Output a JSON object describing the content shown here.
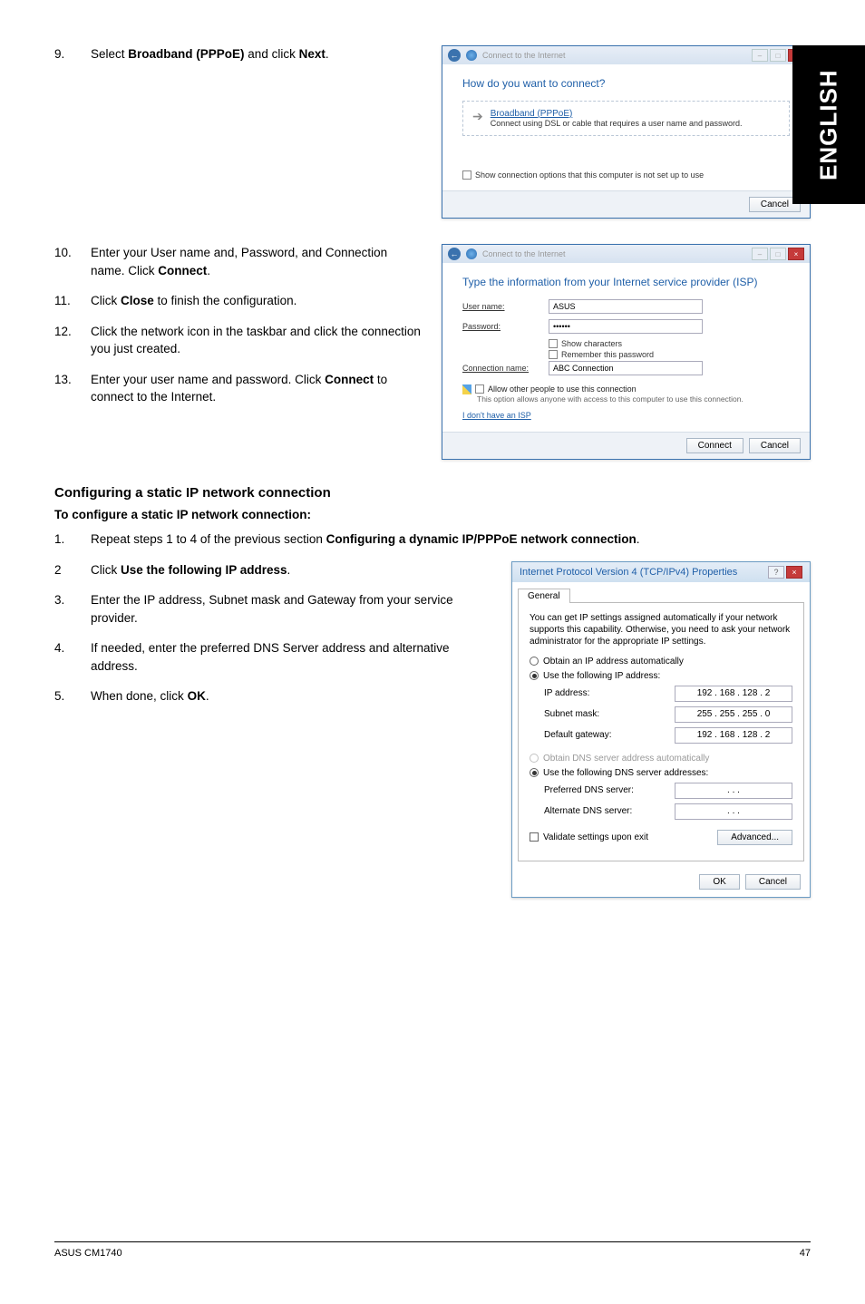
{
  "side_tab": "ENGLISH",
  "step9": {
    "num": "9.",
    "text_pre": "Select ",
    "bold": "Broadband (PPPoE)",
    "text_mid": " and click ",
    "bold2": "Next",
    "dot": "."
  },
  "wizard1": {
    "back_glyph": "←",
    "title": "Connect to the Internet",
    "min": "–",
    "max": "□",
    "close": "×",
    "heading": "How do you want to connect?",
    "opt_title": "Broadband (PPPoE)",
    "opt_sub": "Connect using DSL or cable that requires a user name and password.",
    "show_opts": "Show connection options that this computer is not set up to use",
    "cancel": "Cancel"
  },
  "step10": {
    "num": "10.",
    "l1_pre": "Enter your User name and, Password, and Connection name. Click ",
    "l1_b": "Connect",
    "l1_post": "."
  },
  "step11": {
    "num": "11.",
    "pre": "Click ",
    "b": "Close",
    "post": " to finish the configuration."
  },
  "step12": {
    "num": "12.",
    "text": "Click the network icon in the taskbar and click the connection you just created."
  },
  "step13": {
    "num": "13.",
    "pre": "Enter your user name and password. Click ",
    "b": "Connect",
    "post": " to connect to the Internet."
  },
  "wizard2": {
    "back_glyph": "←",
    "title": "Connect to the Internet",
    "min": "–",
    "max": "□",
    "close": "×",
    "heading": "Type the information from your Internet service provider (ISP)",
    "user_lbl": "User name:",
    "user_val": "ASUS",
    "pass_lbl": "Password:",
    "pass_val": "••••••",
    "show_chars": "Show characters",
    "remember": "Remember this password",
    "conn_lbl": "Connection name:",
    "conn_val": "ABC Connection",
    "allow": "Allow other people to use this connection",
    "allow_sub": "This option allows anyone with access to this computer to use this connection.",
    "no_isp": "I don't have an ISP",
    "connect": "Connect",
    "cancel": "Cancel"
  },
  "section": {
    "h": "Configuring a static IP network connection",
    "sub": "To configure a static IP network connection:"
  },
  "step1b": {
    "num": "1.",
    "pre": "Repeat steps 1 to 4 of the previous section ",
    "b": "Configuring a dynamic IP/PPPoE network connection",
    "post": "."
  },
  "step2b": {
    "num": "2",
    "pre": "Click ",
    "b": "Use the following IP address",
    "post": "."
  },
  "step3b": {
    "num": "3.",
    "text": "Enter the IP address, Subnet mask and Gateway from your service provider."
  },
  "step4b": {
    "num": "4.",
    "text": "If needed, enter the preferred DNS Server address and alternative address."
  },
  "step5b": {
    "num": "5.",
    "pre": "When done, click ",
    "b": "OK",
    "post": "."
  },
  "ipv4": {
    "title": "Internet Protocol Version 4 (TCP/IPv4) Properties",
    "help": "?",
    "close": "×",
    "tab": "General",
    "desc": "You can get IP settings assigned automatically if your network supports this capability. Otherwise, you need to ask your network administrator for the appropriate IP settings.",
    "r1": "Obtain an IP address automatically",
    "r2": "Use the following IP address:",
    "ip_lbl": "IP address:",
    "ip_val": "192 . 168 . 128 .   2",
    "mask_lbl": "Subnet mask:",
    "mask_val": "255 . 255 . 255 .   0",
    "gw_lbl": "Default gateway:",
    "gw_val": "192 . 168 . 128 .   2",
    "r3": "Obtain DNS server address automatically",
    "r4": "Use the following DNS server addresses:",
    "pdns_lbl": "Preferred DNS server:",
    "pdns_val": ".          .          .",
    "adns_lbl": "Alternate DNS server:",
    "adns_val": ".          .          .",
    "validate": "Validate settings upon exit",
    "advanced": "Advanced...",
    "ok": "OK",
    "cancel": "Cancel"
  },
  "footer": {
    "left": "ASUS CM1740",
    "right": "47"
  }
}
